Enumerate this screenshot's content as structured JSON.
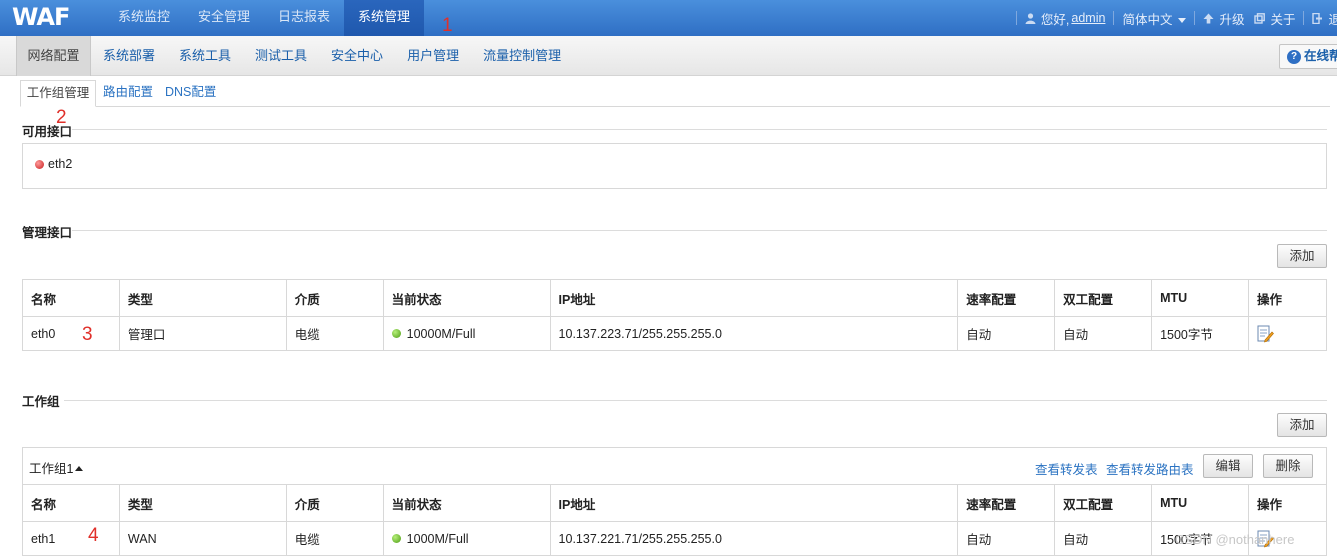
{
  "app": {
    "logo": "WAF"
  },
  "topnav": {
    "items": [
      "系统监控",
      "安全管理",
      "日志报表",
      "系统管理"
    ],
    "active_index": 3
  },
  "topright": {
    "greeting": "您好,",
    "user": "admin",
    "language": "简体中文",
    "upgrade": "升级",
    "about": "关于",
    "logout": "退"
  },
  "subnav": {
    "items": [
      "网络配置",
      "系统部署",
      "系统工具",
      "测试工具",
      "安全中心",
      "用户管理",
      "流量控制管理"
    ],
    "active_index": 0,
    "help": "在线帮"
  },
  "tabs": [
    "工作组管理",
    "路由配置",
    "DNS配置"
  ],
  "annotations": [
    "1",
    "2",
    "3",
    "4"
  ],
  "available": {
    "title": "可用接口",
    "items": [
      {
        "name": "eth2",
        "status": "red"
      }
    ]
  },
  "mgmt": {
    "title": "管理接口",
    "add": "添加",
    "columns": [
      "名称",
      "类型",
      "介质",
      "当前状态",
      "IP地址",
      "速率配置",
      "双工配置",
      "MTU",
      "操作"
    ],
    "rows": [
      {
        "name": "eth0",
        "type": "管理口",
        "medium": "电缆",
        "status": "10000M/Full",
        "ip": "10.137.223.71/255.255.255.0",
        "rate": "自动",
        "duplex": "自动",
        "mtu": "1500字节"
      }
    ]
  },
  "workgroup": {
    "title": "工作组",
    "add": "添加",
    "group_name": "工作组1",
    "link_forward": "查看转发表",
    "link_route": "查看转发路由表",
    "edit": "编辑",
    "delete": "删除",
    "columns": [
      "名称",
      "类型",
      "介质",
      "当前状态",
      "IP地址",
      "速率配置",
      "双工配置",
      "MTU",
      "操作"
    ],
    "rows": [
      {
        "name": "eth1",
        "type": "WAN",
        "medium": "电缆",
        "status": "1000M/Full",
        "ip": "10.137.221.71/255.255.255.0",
        "rate": "自动",
        "duplex": "自动",
        "mtu": "1500字节"
      }
    ]
  },
  "watermark": "CSDN @nothanhere",
  "colors": {
    "topbar": "#2f6fc4",
    "link": "#2b73c2",
    "annotation": "#e0302a"
  }
}
